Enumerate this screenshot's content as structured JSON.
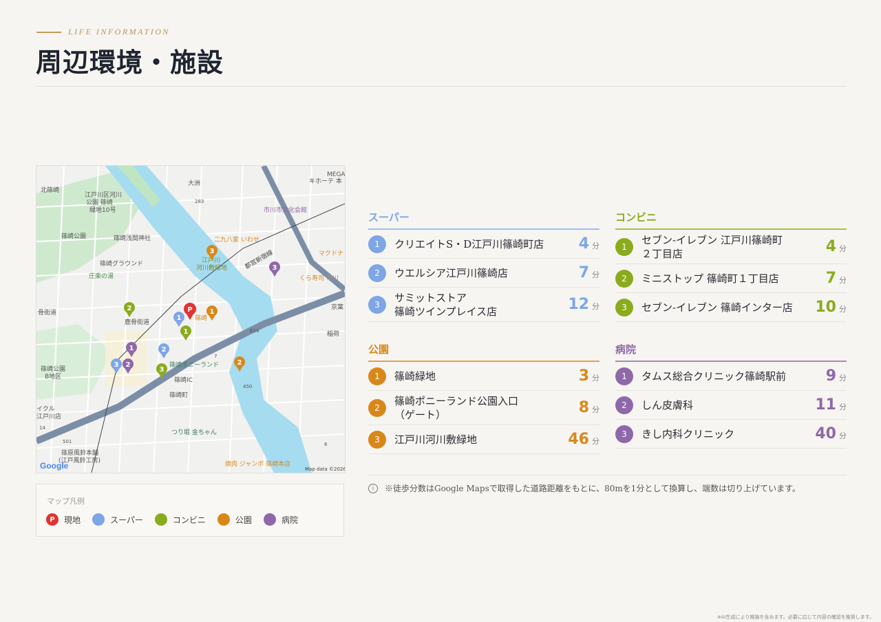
{
  "header": {
    "eyebrow": "LIFE INFORMATION",
    "title": "周辺環境・施設"
  },
  "map": {
    "attribution": "Map data ©2026",
    "brand": "Google",
    "place_labels": [
      {
        "text": "北篠崎"
      },
      {
        "text": "大洲"
      },
      {
        "text": "江戸川区河川"
      },
      {
        "text": "公園 篠崎"
      },
      {
        "text": "緑地10号"
      },
      {
        "text": "篠崎公園"
      },
      {
        "text": "篠崎浅間神社"
      },
      {
        "text": "市川市文化会館"
      },
      {
        "text": "二九八家 いわせ"
      },
      {
        "text": "マクドナ"
      },
      {
        "text": "篠崎グラウンド"
      },
      {
        "text": "江戸川"
      },
      {
        "text": "河川敷緑地"
      },
      {
        "text": "庄楽の湯"
      },
      {
        "text": "くら寿司 市川"
      },
      {
        "text": "骨街道"
      },
      {
        "text": "鹿骨街道"
      },
      {
        "text": "篠崎"
      },
      {
        "text": "稲荷"
      },
      {
        "text": "篠崎ポニーランド"
      },
      {
        "text": "篠崎公園"
      },
      {
        "text": "B地区"
      },
      {
        "text": "篠崎IC"
      },
      {
        "text": "篠崎町"
      },
      {
        "text": "イクル"
      },
      {
        "text": "江戸川店"
      },
      {
        "text": "つり堀 金ちゃん"
      },
      {
        "text": "篠原風鈴本舗"
      },
      {
        "text": "(江戸風鈴工房)"
      },
      {
        "text": "焼肉 ジャンボ 篠崎本店"
      },
      {
        "text": "MEGA"
      },
      {
        "text": "キホーテ 本"
      },
      {
        "text": "都営新宿線"
      },
      {
        "text": "京葉"
      },
      {
        "text": "E14"
      },
      {
        "text": "283"
      },
      {
        "text": "450"
      },
      {
        "text": "501"
      },
      {
        "text": "14"
      },
      {
        "text": "7"
      },
      {
        "text": "6"
      }
    ]
  },
  "legend": {
    "title": "マップ凡例",
    "items": [
      {
        "label": "現地",
        "color": "#e03434",
        "glyph": "P"
      },
      {
        "label": "スーパー",
        "color": "#7ea6e6",
        "glyph": ""
      },
      {
        "label": "コンビニ",
        "color": "#8aab1d",
        "glyph": ""
      },
      {
        "label": "公園",
        "color": "#d8881a",
        "glyph": ""
      },
      {
        "label": "病院",
        "color": "#8e68a8",
        "glyph": ""
      }
    ]
  },
  "sections": {
    "super": {
      "title": "スーパー",
      "color": "#7ea6e6",
      "items": [
        {
          "rank": "1",
          "name": "クリエイトS・D江戸川篠崎町店",
          "minutes": "4",
          "unit": "分"
        },
        {
          "rank": "2",
          "name": "ウエルシア江戸川篠崎店",
          "minutes": "7",
          "unit": "分"
        },
        {
          "rank": "3",
          "name": "サミットストア\n篠崎ツインプレイス店",
          "minutes": "12",
          "unit": "分"
        }
      ]
    },
    "conbini": {
      "title": "コンビニ",
      "color": "#8aab1d",
      "items": [
        {
          "rank": "1",
          "name": "セブン-イレブン 江戸川篠崎町\n２丁目店",
          "minutes": "4",
          "unit": "分"
        },
        {
          "rank": "2",
          "name": "ミニストップ 篠崎町１丁目店",
          "minutes": "7",
          "unit": "分"
        },
        {
          "rank": "3",
          "name": "セブン-イレブン 篠崎インター店",
          "minutes": "10",
          "unit": "分"
        }
      ]
    },
    "park": {
      "title": "公園",
      "color": "#d8881a",
      "items": [
        {
          "rank": "1",
          "name": "篠崎緑地",
          "minutes": "3",
          "unit": "分"
        },
        {
          "rank": "2",
          "name": "篠崎ポニーランド公園入口\n（ゲート）",
          "minutes": "8",
          "unit": "分"
        },
        {
          "rank": "3",
          "name": "江戸川河川敷緑地",
          "minutes": "46",
          "unit": "分"
        }
      ]
    },
    "hospital": {
      "title": "病院",
      "color": "#8e68a8",
      "items": [
        {
          "rank": "1",
          "name": "タムス総合クリニック篠崎駅前",
          "minutes": "9",
          "unit": "分"
        },
        {
          "rank": "2",
          "name": "しん皮膚科",
          "minutes": "11",
          "unit": "分"
        },
        {
          "rank": "3",
          "name": "きし内科クリニック",
          "minutes": "40",
          "unit": "分"
        }
      ]
    }
  },
  "note": {
    "icon": "info-icon",
    "text": "※徒歩分数はGoogle Mapsで取得した道路距離をもとに、80mを1分として換算し、端数は切り上げています。"
  },
  "footer": "※AI生成により推論を含みます。必要に応じて内容の確認を推奨します。"
}
